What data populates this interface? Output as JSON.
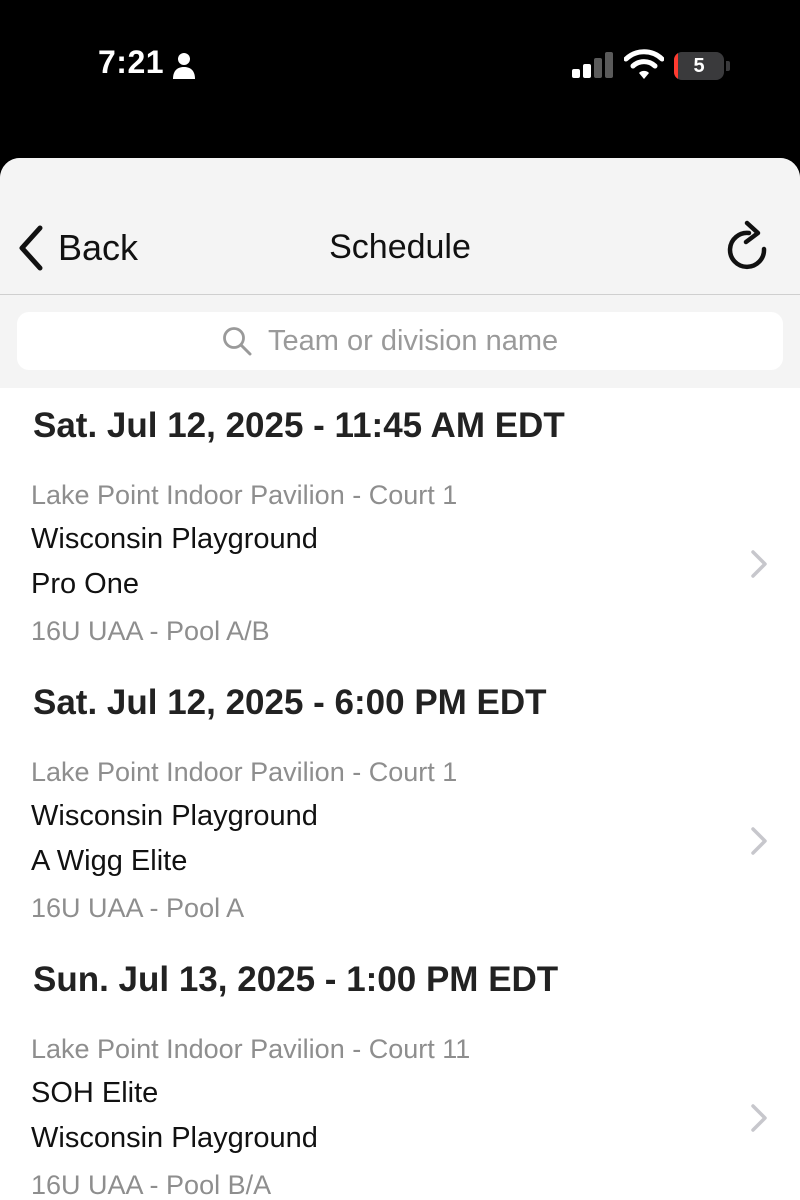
{
  "status_bar": {
    "time": "7:21",
    "battery_level": "5",
    "battery_fraction": 0.05,
    "battery_color": "#ff3b30",
    "icons": [
      "person-icon",
      "cellular-signal-icon",
      "wifi-icon",
      "battery-icon"
    ]
  },
  "nav": {
    "back_label": "Back",
    "title": "Schedule",
    "back_icon": "chevron-left-icon",
    "refresh_icon": "refresh-icon"
  },
  "search": {
    "placeholder": "Team or division name",
    "value": "",
    "icon": "search-icon"
  },
  "games": [
    {
      "date": "Sat. Jul 12, 2025 - 11:45 AM EDT",
      "location": "Lake Point Indoor Pavilion - Court 1",
      "team1": "Wisconsin Playground",
      "team2": "Pro One",
      "division": "16U UAA - Pool A/B"
    },
    {
      "date": "Sat. Jul 12, 2025 - 6:00 PM EDT",
      "location": "Lake Point Indoor Pavilion - Court 1",
      "team1": "Wisconsin Playground",
      "team2": "A Wigg Elite",
      "division": "16U UAA - Pool A"
    },
    {
      "date": "Sun. Jul 13, 2025 - 1:00 PM EDT",
      "location": "Lake Point Indoor Pavilion - Court 11",
      "team1": "SOH Elite",
      "team2": "Wisconsin Playground",
      "division": "16U UAA - Pool B/A"
    }
  ]
}
